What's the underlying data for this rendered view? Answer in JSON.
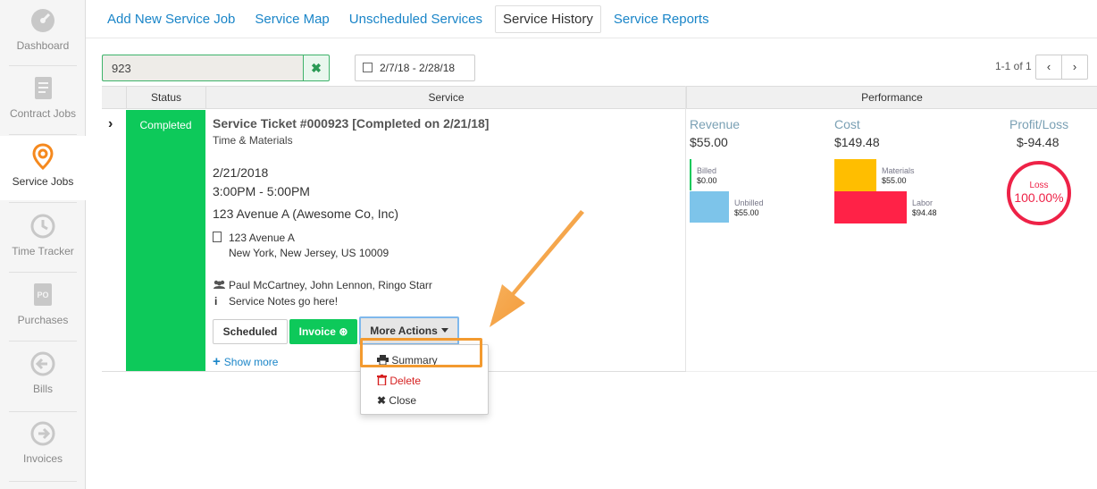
{
  "sidebar": {
    "items": [
      {
        "label": "Dashboard",
        "icon": "dashboard-icon"
      },
      {
        "label": "Contract Jobs",
        "icon": "contract-icon"
      },
      {
        "label": "Service Jobs",
        "icon": "location-pin-icon"
      },
      {
        "label": "Time Tracker",
        "icon": "clock-icon"
      },
      {
        "label": "Purchases",
        "icon": "po-icon"
      },
      {
        "label": "Bills",
        "icon": "arrow-left-circle-icon"
      },
      {
        "label": "Invoices",
        "icon": "arrow-right-circle-icon"
      }
    ],
    "active_color": "#f5891e"
  },
  "topnav": {
    "tabs": [
      {
        "label": "Add New Service Job"
      },
      {
        "label": "Service Map"
      },
      {
        "label": "Unscheduled Services"
      },
      {
        "label": "Service History"
      },
      {
        "label": "Service Reports"
      }
    ]
  },
  "filters": {
    "search_value": "923",
    "clear_icon": "✖",
    "date_range": "2/7/18 - 2/28/18"
  },
  "pager": {
    "text": "1-1 of 1",
    "prev": "‹",
    "next": "›"
  },
  "table": {
    "headers": {
      "status": "Status",
      "service": "Service",
      "performance": "Performance"
    }
  },
  "job": {
    "expander": "›",
    "status": "Completed",
    "title": "Service Ticket #000923 [Completed on 2/21/18]",
    "type": "Time & Materials",
    "date": "2/21/2018",
    "time": "3:00PM - 5:00PM",
    "client": "123 Avenue A (Awesome Co, Inc)",
    "address_line1": "123 Avenue A",
    "address_line2": "New York, New Jersey, US 10009",
    "crew": "Paul McCartney, John Lennon, Ringo Starr",
    "notes": "Service Notes go here!",
    "info_icon": "i",
    "buttons": {
      "scheduled": "Scheduled",
      "invoice": "Invoice",
      "invoice_icon": "⊛",
      "more_actions": "More Actions"
    },
    "show_more": "Show more",
    "show_more_icon": "+"
  },
  "dropdown": {
    "items": [
      {
        "label": "Summary",
        "icon": "printer-icon"
      },
      {
        "label": "Delete",
        "icon": "trash-icon"
      },
      {
        "label": "Close",
        "icon": "close-icon"
      }
    ]
  },
  "performance": {
    "revenue": {
      "label": "Revenue",
      "value": "$55.00",
      "billed_label": "Billed",
      "billed_value": "$0.00",
      "unbilled_label": "Unbilled",
      "unbilled_value": "$55.00"
    },
    "cost": {
      "label": "Cost",
      "value": "$149.48",
      "materials_label": "Materials",
      "materials_value": "$55.00",
      "labor_label": "Labor",
      "labor_value": "$94.48"
    },
    "profit": {
      "label": "Profit/Loss",
      "value": "$-94.48",
      "badge_label": "Loss",
      "badge_value": "100.00%"
    },
    "colors": {
      "billed": "#0dc95a",
      "unbilled": "#7dc4ea",
      "materials": "#ffbe00",
      "labor": "#ff2247",
      "loss": "#ee2247"
    }
  },
  "colors": {
    "accent": "#1a85c8",
    "completed": "#0dc95a",
    "highlight": "#f39a2f"
  }
}
